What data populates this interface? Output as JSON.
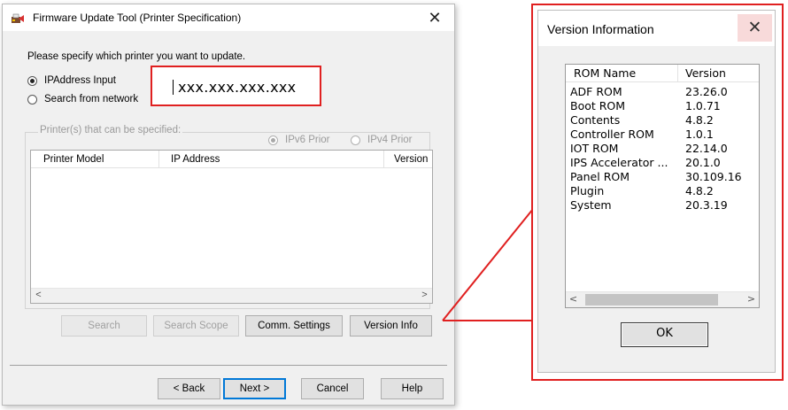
{
  "main_dialog": {
    "title": "Firmware Update Tool (Printer Specification)",
    "close_glyph": "✕",
    "prompt": "Please specify which printer you want to update.",
    "radio_ip": "IPAddress Input",
    "radio_search": "Search from network",
    "ip_value": "xxx.xxx.xxx.xxx",
    "group_label": "Printer(s) that can be specified:",
    "ipv6": "IPv6 Prior",
    "ipv4": "IPv4 Prior",
    "columns": [
      "Printer Model",
      "IP Address",
      "Version"
    ],
    "scroll_left": "<",
    "scroll_right": ">",
    "buttons": {
      "search": "Search",
      "search_scope": "Search Scope",
      "comm_settings": "Comm. Settings",
      "version_info": "Version Info",
      "back": "< Back",
      "next": "Next >",
      "cancel": "Cancel",
      "help": "Help"
    }
  },
  "version_dialog": {
    "title": "Version Information",
    "close_glyph": "✕",
    "col_name": "ROM Name",
    "col_version": "Version",
    "rows": [
      {
        "name": "ADF ROM",
        "version": "23.26.0"
      },
      {
        "name": "Boot ROM",
        "version": "1.0.71"
      },
      {
        "name": "Contents",
        "version": "4.8.2"
      },
      {
        "name": "Controller ROM",
        "version": "1.0.1"
      },
      {
        "name": "IOT ROM",
        "version": "22.14.0"
      },
      {
        "name": "IPS Accelerator ...",
        "version": "20.1.0"
      },
      {
        "name": "Panel ROM",
        "version": "30.109.16"
      },
      {
        "name": "Plugin",
        "version": "4.8.2"
      },
      {
        "name": "System",
        "version": "20.3.19"
      }
    ],
    "scroll_left": "<",
    "scroll_right": ">",
    "ok": "OK"
  },
  "colors": {
    "highlight": "#e02020",
    "dialog_bg": "#f0f0f0",
    "default_button_border": "#0078d7"
  },
  "icons": {
    "app": "printer-update-icon",
    "close": "close-icon"
  }
}
